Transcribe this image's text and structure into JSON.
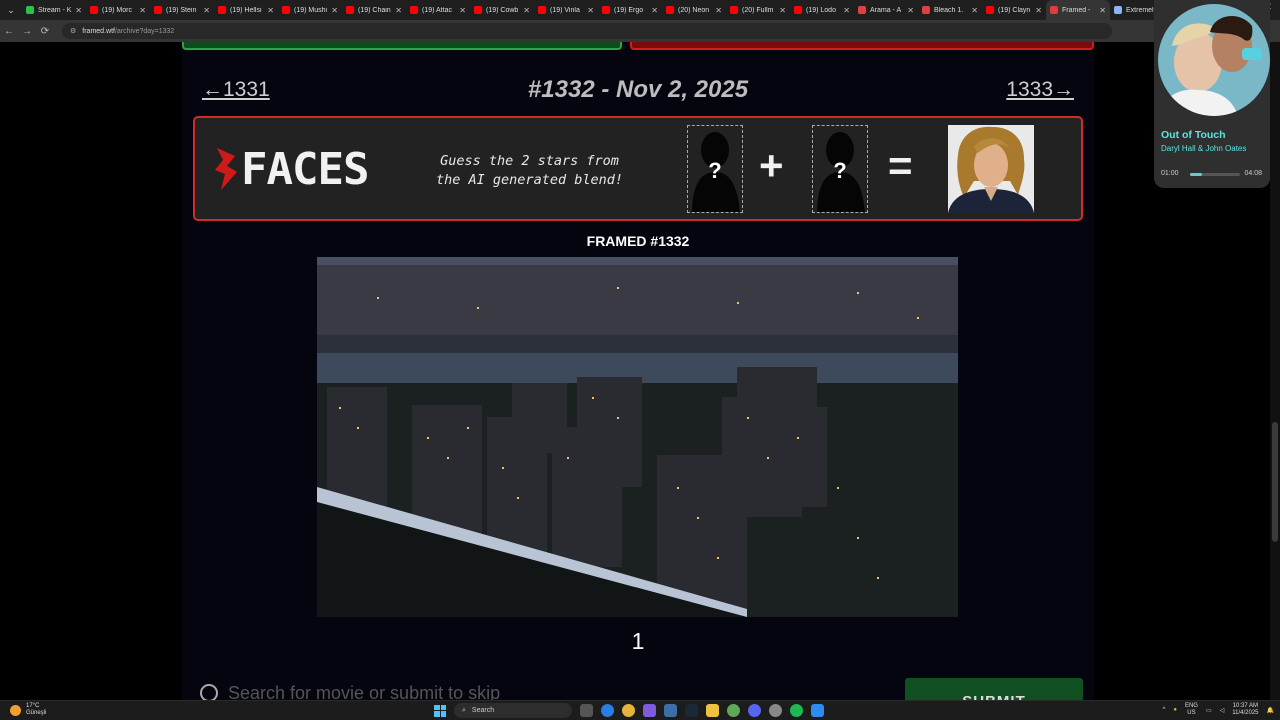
{
  "browser": {
    "tabs": [
      {
        "title": "Stream - K",
        "color": "#29c24a"
      },
      {
        "title": "(19) Morc",
        "color": "#ff0000"
      },
      {
        "title": "(19) Stein",
        "color": "#ff0000"
      },
      {
        "title": "(19) Hellsi",
        "color": "#ff0000"
      },
      {
        "title": "(19) Mushi",
        "color": "#ff0000"
      },
      {
        "title": "(19) Chain",
        "color": "#ff0000"
      },
      {
        "title": "(19) Attac",
        "color": "#ff0000"
      },
      {
        "title": "(19) Cowb",
        "color": "#ff0000"
      },
      {
        "title": "(19) Vinla",
        "color": "#ff0000"
      },
      {
        "title": "(19) Ergo",
        "color": "#ff0000"
      },
      {
        "title": "(20) Neon",
        "color": "#ff0000"
      },
      {
        "title": "(20) Fullm",
        "color": "#ff0000"
      },
      {
        "title": "(19) Lodo",
        "color": "#ff0000"
      },
      {
        "title": "Arama - A",
        "color": "#e04040"
      },
      {
        "title": "Bleach 1.",
        "color": "#e04040"
      },
      {
        "title": "(19) Clayn",
        "color": "#ff0000"
      },
      {
        "title": "Framed -",
        "color": "#e23b3b",
        "active": true
      },
      {
        "title": "Extremely",
        "color": "#8ab4f8"
      }
    ],
    "url_host": "framed.wtf",
    "url_path": "/archive?day=1332"
  },
  "game": {
    "prev_link": "←1331",
    "next_link": "1333→",
    "title": "#1332 - Nov 2, 2025",
    "faces_banner": {
      "logo_text": "FACES",
      "tagline_line1": "Guess the 2 stars from",
      "tagline_line2": "the AI generated blend!",
      "slot1": "?",
      "plus": "+",
      "slot2": "?",
      "equals": "="
    },
    "framed_label": "FRAMED #1332",
    "guess_number": "1",
    "search_placeholder": "Search for movie or submit to skip",
    "submit_label": "SUBMIT"
  },
  "music": {
    "song": "Out of Touch",
    "artist": "Daryl Hall & John Oates",
    "time_current": "01:00",
    "time_total": "04:08",
    "progress": 0.24
  },
  "taskbar": {
    "temp": "17°C",
    "condition": "Güneşli",
    "search": "Search",
    "lang1": "ENG",
    "lang2": "US",
    "time": "10:37 AM",
    "date": "11/4/2025"
  }
}
